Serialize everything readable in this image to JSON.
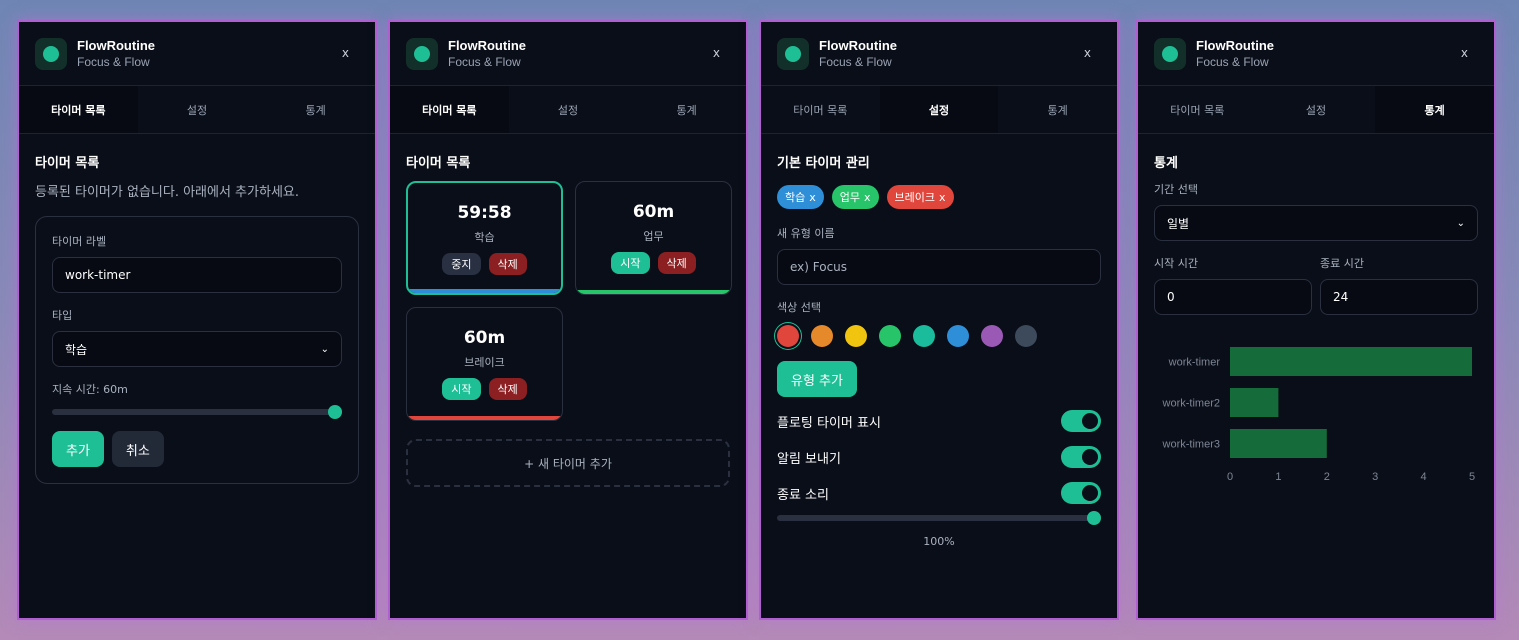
{
  "app": {
    "title": "FlowRoutine",
    "subtitle": "Focus & Flow",
    "close": "x"
  },
  "tabs": [
    "타이머 목록",
    "설정",
    "통계"
  ],
  "panel1": {
    "title": "타이머 목록",
    "empty": "등록된 타이머가 없습니다. 아래에서 추가하세요.",
    "label_label": "타이머 라벨",
    "label_value": "work-timer",
    "type_label": "타입",
    "type_value": "학습",
    "duration_label": "지속 시간: 60m",
    "duration_fraction": 1.0,
    "add": "추가",
    "cancel": "취소"
  },
  "panel2": {
    "title": "타이머 목록",
    "timers": [
      {
        "time": "59:58",
        "label": "학습",
        "primary": "중지",
        "delete": "삭제",
        "color": "#2e8fd8",
        "active": true
      },
      {
        "time": "60m",
        "label": "업무",
        "primary": "시작",
        "delete": "삭제",
        "color": "#27c46a",
        "active": false
      },
      {
        "time": "60m",
        "label": "브레이크",
        "primary": "시작",
        "delete": "삭제",
        "color": "#e0463c",
        "active": false
      }
    ],
    "add_new": "+ 새 타이머 추가"
  },
  "panel3": {
    "title": "기본 타이머 관리",
    "chips": [
      {
        "label": "학습",
        "x": "x",
        "color": "#2e8fd8"
      },
      {
        "label": "업무",
        "x": "x",
        "color": "#27c46a"
      },
      {
        "label": "브레이크",
        "x": "x",
        "color": "#e0463c"
      }
    ],
    "new_type_label": "새 유형 이름",
    "new_type_placeholder": "ex) Focus",
    "color_label": "색상 선택",
    "colors": [
      "#e0463c",
      "#e6892a",
      "#f1c40f",
      "#27c46a",
      "#1abc9c",
      "#2e8fd8",
      "#9b59b6",
      "#3d4a5c"
    ],
    "add_type": "유형 추가",
    "toggles": [
      {
        "label": "플로팅 타이머 표시",
        "on": true
      },
      {
        "label": "알림 보내기",
        "on": true
      },
      {
        "label": "종료 소리",
        "on": true
      }
    ],
    "volume_fraction": 1.0,
    "volume_text": "100%"
  },
  "panel4": {
    "title": "통계",
    "period_label": "기간 선택",
    "period_value": "일별",
    "start_label": "시작 시간",
    "start_value": "0",
    "end_label": "종료 시간",
    "end_value": "24"
  },
  "chart_data": {
    "type": "bar",
    "orientation": "horizontal",
    "categories": [
      "work-timer",
      "work-timer2",
      "work-timer3"
    ],
    "values": [
      5,
      1,
      2
    ],
    "xlim": [
      0,
      5
    ],
    "xticks": [
      "0",
      "1",
      "2",
      "3",
      "4",
      "5"
    ],
    "color": "#166b3a",
    "grid": false
  }
}
